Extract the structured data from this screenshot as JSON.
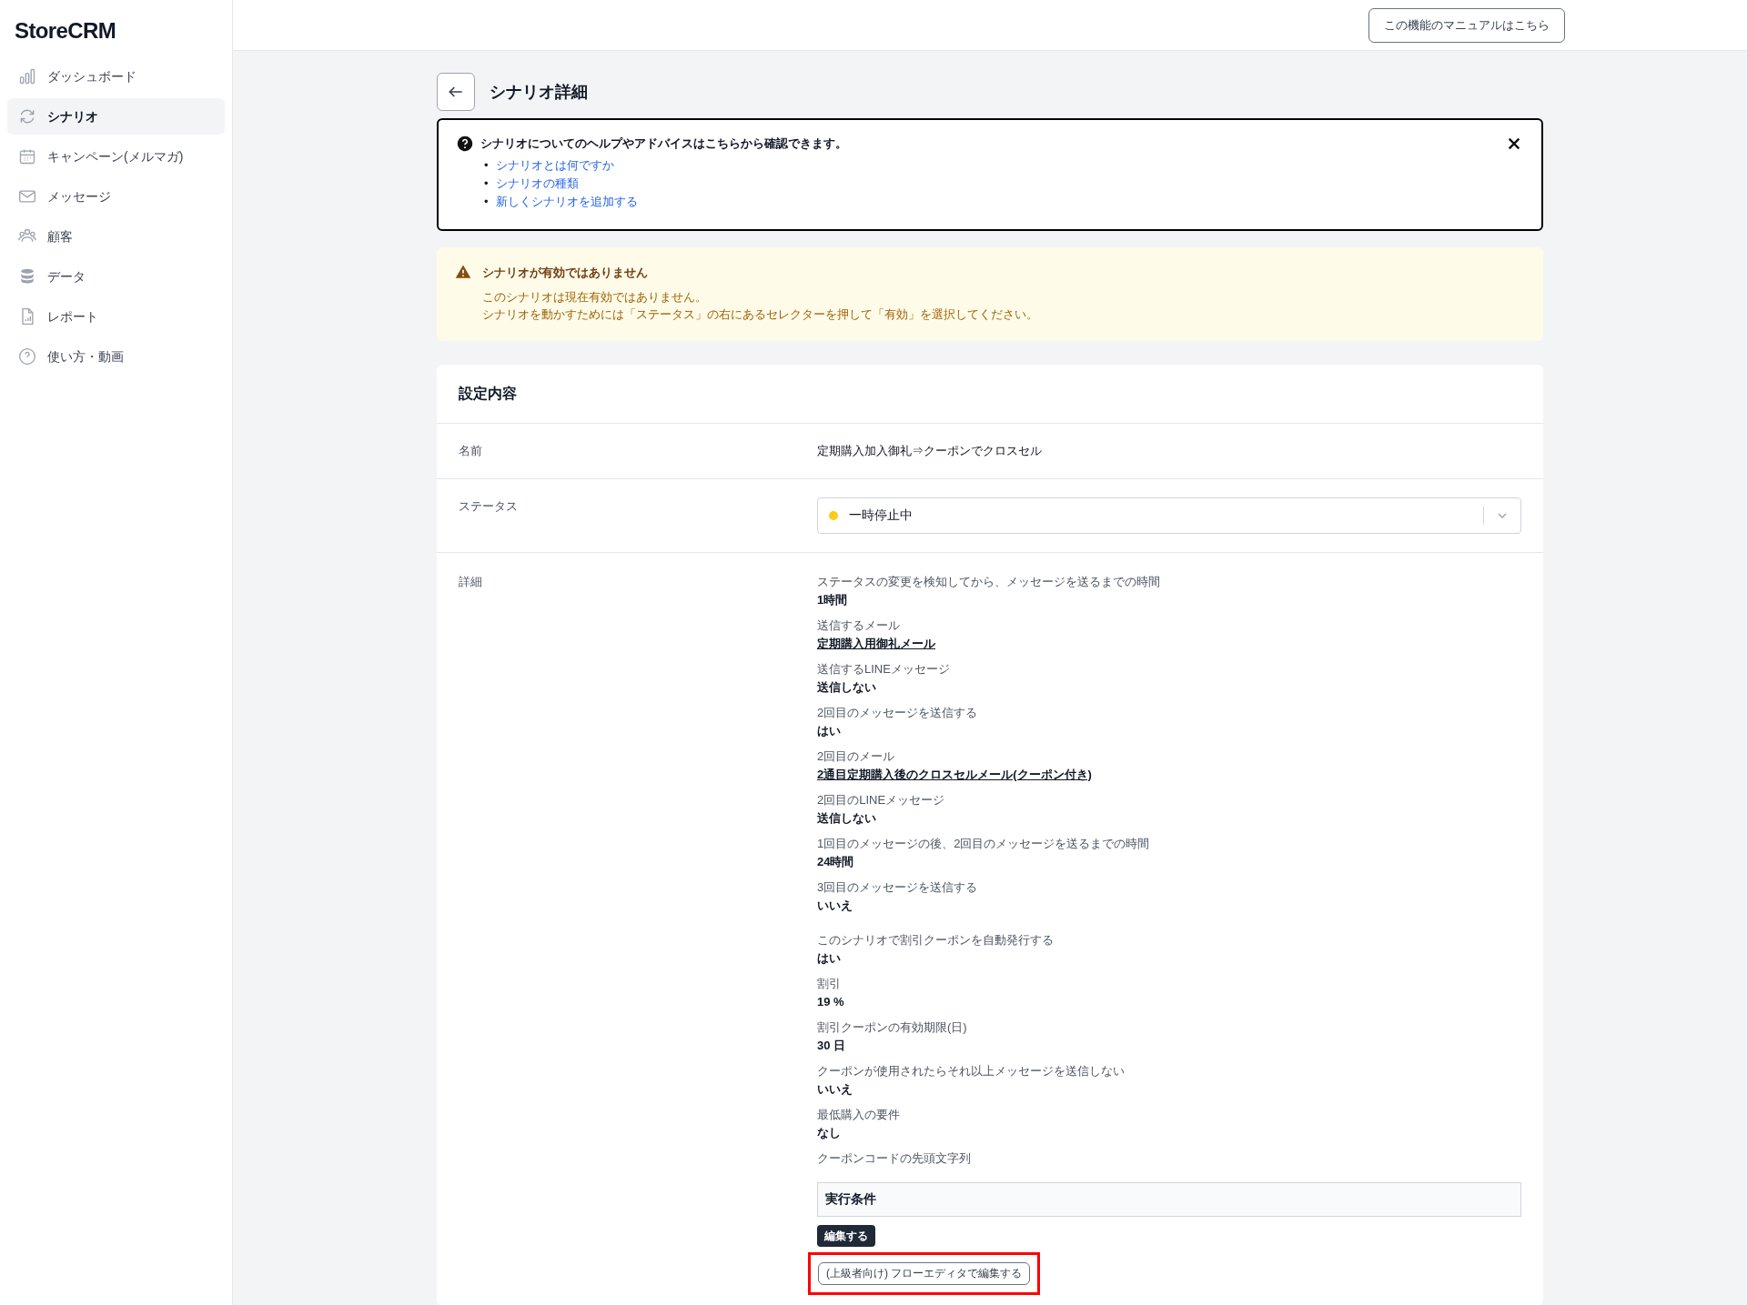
{
  "sidebar": {
    "logo": "StoreCRM",
    "items": [
      {
        "label": "ダッシュボード",
        "selected": false
      },
      {
        "label": "シナリオ",
        "selected": true
      },
      {
        "label": "キャンペーン(メルマガ)",
        "selected": false
      },
      {
        "label": "メッセージ",
        "selected": false
      },
      {
        "label": "顧客",
        "selected": false
      },
      {
        "label": "データ",
        "selected": false
      },
      {
        "label": "レポート",
        "selected": false
      },
      {
        "label": "使い方・動画",
        "selected": false
      }
    ]
  },
  "header": {
    "manual_button": "この機能のマニュアルはこちら"
  },
  "page_title": "シナリオ詳細",
  "help_box": {
    "text": "シナリオについてのヘルプやアドバイスはこちらから確認できます。",
    "links": [
      {
        "bullet": "•",
        "label": "シナリオとは何ですか"
      },
      {
        "bullet": "•",
        "label": "シナリオの種類"
      },
      {
        "bullet": "•",
        "label": "新しくシナリオを追加する"
      }
    ]
  },
  "warning": {
    "title": "シナリオが有効ではありません",
    "lines": [
      "このシナリオは現在有効ではありません。",
      "シナリオを動かすためには「ステータス」の右にあるセレクターを押して「有効」を選択してください。"
    ]
  },
  "settings": {
    "title": "設定内容",
    "name": {
      "label": "名前",
      "value": "定期購入加入御礼⇒クーポンでクロスセル"
    },
    "status": {
      "label": "ステータス",
      "value": "一時停止中",
      "color": "#facc15"
    },
    "details": {
      "label": "詳細",
      "items": [
        {
          "label": "ステータスの変更を検知してから、メッセージを送るまでの時間",
          "value": "1時間",
          "kind": "text"
        },
        {
          "label": "送信するメール",
          "value": "定期購入用御礼メール",
          "kind": "link"
        },
        {
          "label": "送信するLINEメッセージ",
          "value": "送信しない",
          "kind": "text"
        },
        {
          "label": "2回目のメッセージを送信する",
          "value": "はい",
          "kind": "text"
        },
        {
          "label": "2回目のメール",
          "value": "2通目定期購入後のクロスセルメール(クーポン付き)",
          "kind": "link"
        },
        {
          "label": "2回目のLINEメッセージ",
          "value": "送信しない",
          "kind": "text"
        },
        {
          "label": "1回目のメッセージの後、2回目のメッセージを送るまでの時間",
          "value": "24時間",
          "kind": "text"
        },
        {
          "label": "3回目のメッセージを送信する",
          "value": "いいえ",
          "kind": "text"
        },
        {
          "label": "このシナリオで割引クーポンを自動発行する",
          "value": "はい",
          "kind": "text"
        },
        {
          "label": "割引",
          "value": "19 %",
          "kind": "text"
        },
        {
          "label": "割引クーポンの有効期限(日)",
          "value": "30 日",
          "kind": "text"
        },
        {
          "label": "クーポンが使用されたらそれ以上メッセージを送信しない",
          "value": "いいえ",
          "kind": "text"
        },
        {
          "label": "最低購入の要件",
          "value": "なし",
          "kind": "text"
        },
        {
          "label": "クーポンコードの先頭文字列"
        }
      ],
      "conditions_title": "実行条件",
      "edit_button": "編集する",
      "flow_editor_button": {
        "label": "(上級者向け) フローエディタで編集する",
        "highlighted": true
      }
    }
  }
}
